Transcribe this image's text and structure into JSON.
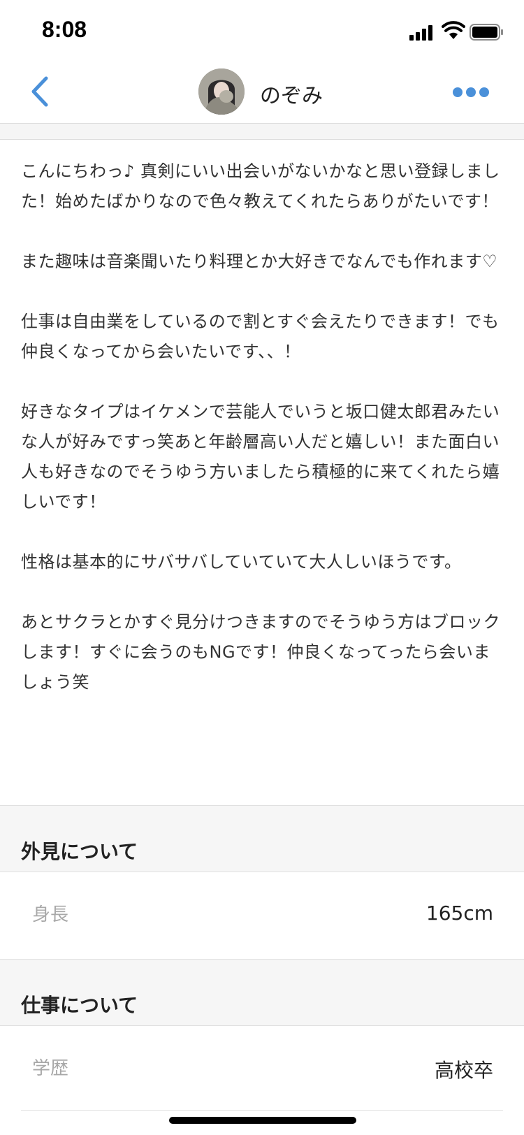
{
  "status_bar": {
    "time": "8:08"
  },
  "nav": {
    "title": "のぞみ",
    "accent_color": "#4a90d9",
    "back_icon": "chevron-left-icon",
    "more_icon": "ellipsis-icon"
  },
  "bio": {
    "paragraphs": [
      "こんにちわっ♪ 真剣にいい出会いがないかなと思い登録しました！始めたばかりなので色々教えてくれたらありがたいです！",
      "また趣味は音楽聞いたり料理とか大好きでなんでも作れます♡",
      "仕事は自由業をしているので割とすぐ会えたりできます！でも仲良くなってから会いたいです、、！",
      "好きなタイプはイケメンで芸能人でいうと坂口健太郎君みたいな人が好みですっ笑あと年齢層高い人だと嬉しい！また面白い人も好きなのでそうゆう方いましたら積極的に来てくれたら嬉しいです！",
      "性格は基本的にサバサバしていていて大人しいほうです。",
      "あとサクラとかすぐ見分けつきますのでそうゆう方はブロックします！すぐに会うのもNGです！仲良くなってったら会いましょう笑"
    ]
  },
  "sections": [
    {
      "title": "外見について",
      "rows": [
        {
          "label": "身長",
          "value": "165cm"
        }
      ]
    },
    {
      "title": "仕事について",
      "rows": [
        {
          "label": "学歴",
          "value": "高校卒"
        }
      ]
    }
  ]
}
